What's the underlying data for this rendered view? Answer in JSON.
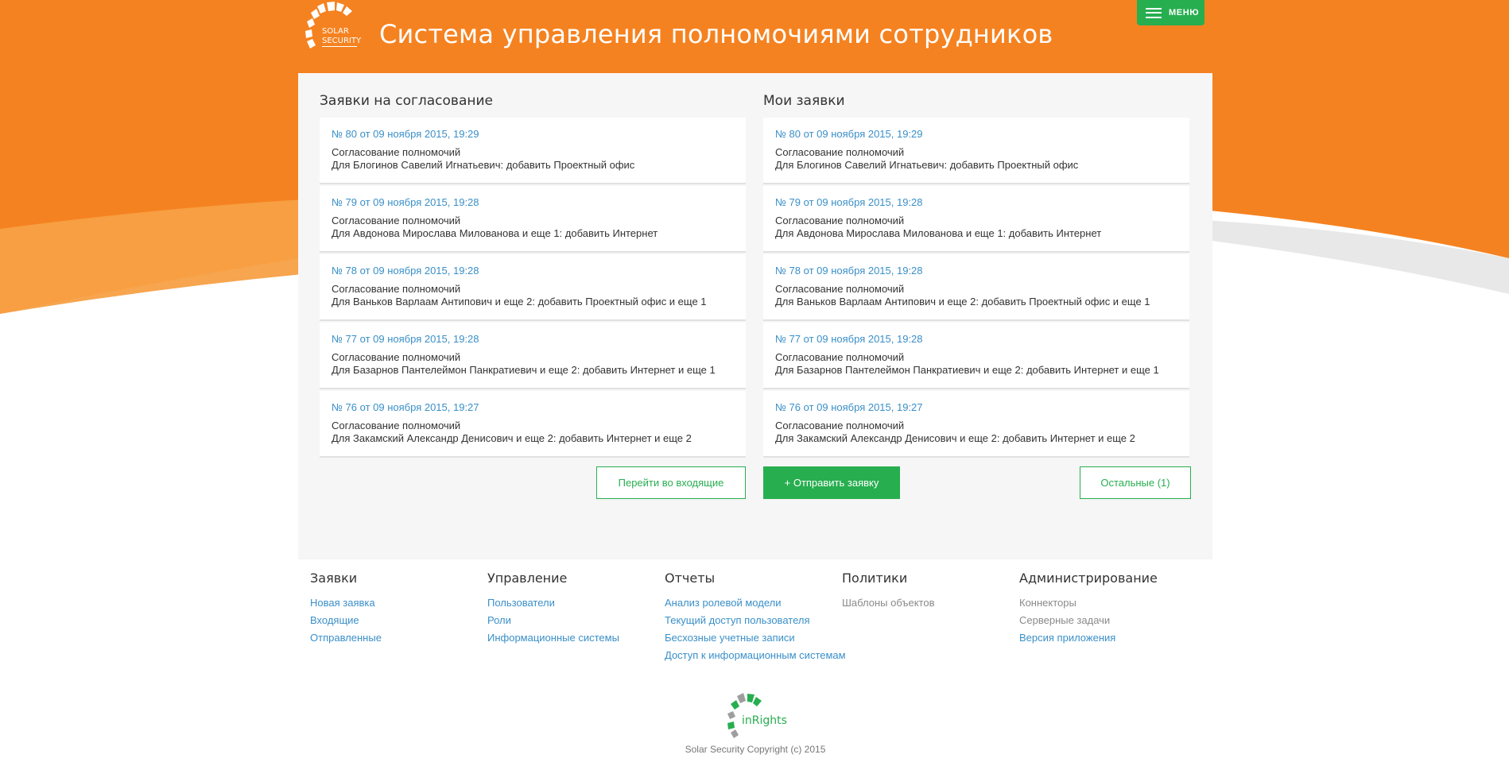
{
  "header": {
    "logo_text": [
      "SOLAR",
      "SECURITY"
    ],
    "title": "Система управления полномочиями сотрудников",
    "menu_label": "МЕНЮ"
  },
  "colors": {
    "brand_orange": "#f58220",
    "accent_green": "#27ae4f",
    "link_blue": "#3a8fc8"
  },
  "approvals": {
    "title": "Заявки на согласование",
    "items": [
      {
        "link": "№ 80 от 09 ноября 2015, 19:29",
        "type": "Согласование полномочий",
        "desc": "Для Блогинов Савелий Игнатьевич: добавить Проектный офис"
      },
      {
        "link": "№ 79 от 09 ноября 2015, 19:28",
        "type": "Согласование полномочий",
        "desc": "Для Авдонова Мирослава Милованова и еще 1: добавить Интернет"
      },
      {
        "link": "№ 78 от 09 ноября 2015, 19:28",
        "type": "Согласование полномочий",
        "desc": "Для Ваньков Варлаам Антипович и еще 2: добавить Проектный офис и еще 1"
      },
      {
        "link": "№ 77 от 09 ноября 2015, 19:28",
        "type": "Согласование полномочий",
        "desc": "Для Базарнов Пантелеймон Панкратиевич и еще 2: добавить Интернет и еще 1"
      },
      {
        "link": "№ 76 от 09 ноября 2015, 19:27",
        "type": "Согласование полномочий",
        "desc": "Для Закамский Александр Денисович и еще 2: добавить Интернет и еще 2"
      }
    ],
    "inbox_button": "Перейти во входящие"
  },
  "my_requests": {
    "title": "Мои заявки",
    "items": [
      {
        "link": "№ 80 от 09 ноября 2015, 19:29",
        "type": "Согласование полномочий",
        "desc": "Для Блогинов Савелий Игнатьевич: добавить Проектный офис"
      },
      {
        "link": "№ 79 от 09 ноября 2015, 19:28",
        "type": "Согласование полномочий",
        "desc": "Для Авдонова Мирослава Милованова и еще 1: добавить Интернет"
      },
      {
        "link": "№ 78 от 09 ноября 2015, 19:28",
        "type": "Согласование полномочий",
        "desc": "Для Ваньков Варлаам Антипович и еще 2: добавить Проектный офис и еще 1"
      },
      {
        "link": "№ 77 от 09 ноября 2015, 19:28",
        "type": "Согласование полномочий",
        "desc": "Для Базарнов Пантелеймон Панкратиевич и еще 2: добавить Интернет и еще 1"
      },
      {
        "link": "№ 76 от 09 ноября 2015, 19:27",
        "type": "Согласование полномочий",
        "desc": "Для Закамский Александр Денисович и еще 2: добавить Интернет и еще 2"
      }
    ],
    "send_button": "+ Отправить заявку",
    "others_button": "Остальные (1)"
  },
  "footer_nav": [
    {
      "title": "Заявки",
      "links": [
        {
          "label": "Новая заявка",
          "muted": false
        },
        {
          "label": "Входящие",
          "muted": false
        },
        {
          "label": "Отправленные",
          "muted": false
        }
      ]
    },
    {
      "title": "Управление",
      "links": [
        {
          "label": "Пользователи",
          "muted": false
        },
        {
          "label": "Роли",
          "muted": false
        },
        {
          "label": "Информационные системы",
          "muted": false
        }
      ]
    },
    {
      "title": "Отчеты",
      "links": [
        {
          "label": "Анализ ролевой модели",
          "muted": false
        },
        {
          "label": "Текущий доступ пользователя",
          "muted": false
        },
        {
          "label": "Бесхозные учетные записи",
          "muted": false
        },
        {
          "label": "Доступ к информационным системам",
          "muted": false
        }
      ]
    },
    {
      "title": "Политики",
      "links": [
        {
          "label": "Шаблоны объектов",
          "muted": true
        }
      ]
    },
    {
      "title": "Администрирование",
      "links": [
        {
          "label": "Коннекторы",
          "muted": true
        },
        {
          "label": "Серверные задачи",
          "muted": true
        },
        {
          "label": "Версия приложения",
          "muted": false
        }
      ]
    }
  ],
  "footer": {
    "product_logo_text": "inRights",
    "copyright": "Solar Security Copyright (c) 2015"
  }
}
